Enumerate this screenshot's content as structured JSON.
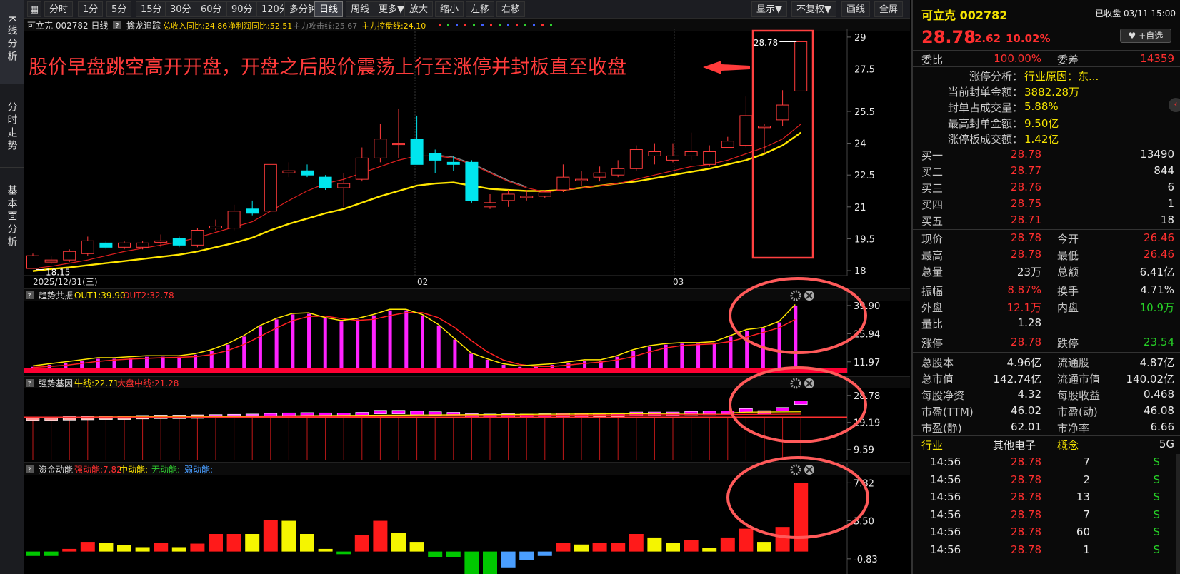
{
  "sidebar": {
    "tabs": [
      "K线分析",
      "分时走势",
      "基本面分析"
    ]
  },
  "toolbar": {
    "periods": [
      "分时",
      "1分",
      "5分",
      "15分",
      "30分",
      "60分",
      "90分",
      "120分",
      "多分钟",
      "日线",
      "周线",
      "更多▼"
    ],
    "active_period": "日线",
    "actions": [
      "放大",
      "缩小",
      "左移",
      "右移"
    ],
    "right_actions": [
      "显示▼",
      "不复权▼",
      "画线",
      "全屏"
    ]
  },
  "chart_header": {
    "symbol_tag": "可立克 002782 日线",
    "help": "?",
    "indicator_name": "擒龙追踪",
    "income": "总收入同比:24.86",
    "profit": "净利润同比:52.51",
    "attack": "主力攻击线:25.67",
    "control": "主力控盘线:24.10"
  },
  "annotation": {
    "text": "股价早盘跳空高开开盘，开盘之后股价震荡上行至涨停并封板直至收盘",
    "arrow": "←"
  },
  "price_labels": {
    "high_marker": "28.78",
    "low_marker": "18.15"
  },
  "x_axis": {
    "date_start": "2025/12/31(三)",
    "month_02": "02",
    "month_03": "03"
  },
  "panel1": {
    "help": "?",
    "name": "趋势共振",
    "out1": "OUT1:39.90",
    "out2": "OUT2:32.78",
    "ticks": [
      "39.90",
      "25.94",
      "11.97"
    ]
  },
  "panel2": {
    "help": "?",
    "name": "强势基因",
    "bull": "牛线:22.71",
    "market": "大盘中线:21.28",
    "ticks": [
      "28.78",
      "19.19",
      "9.59"
    ]
  },
  "panel3": {
    "help": "?",
    "name": "资金动能",
    "strong": "强动能:7.82",
    "medium": "中动能:-",
    "none": "无动能:-",
    "weak": "弱动能:-",
    "ticks": [
      "7.82",
      "3.50",
      "-0.83"
    ]
  },
  "chart_data": {
    "type": "candlestick",
    "y_ticks": [
      29.0,
      27.5,
      25.5,
      24.0,
      22.5,
      21.0,
      19.5,
      18.0
    ],
    "ylim": [
      17.9,
      29.4
    ],
    "candles": [
      {
        "o": 18.1,
        "c": 18.7,
        "h": 18.8,
        "l": 18.1
      },
      {
        "o": 18.4,
        "c": 18.5,
        "h": 18.7,
        "l": 18.3
      },
      {
        "o": 18.5,
        "c": 18.9,
        "h": 19.0,
        "l": 18.4
      },
      {
        "o": 18.8,
        "c": 19.4,
        "h": 19.6,
        "l": 18.7
      },
      {
        "o": 19.3,
        "c": 19.1,
        "h": 19.4,
        "l": 19.0
      },
      {
        "o": 19.1,
        "c": 19.3,
        "h": 19.4,
        "l": 19.0
      },
      {
        "o": 19.1,
        "c": 19.3,
        "h": 19.4,
        "l": 19.0
      },
      {
        "o": 19.4,
        "c": 19.4,
        "h": 19.7,
        "l": 19.1
      },
      {
        "o": 19.5,
        "c": 19.2,
        "h": 19.6,
        "l": 19.1
      },
      {
        "o": 19.2,
        "c": 19.9,
        "h": 20.0,
        "l": 19.1
      },
      {
        "o": 20.0,
        "c": 20.1,
        "h": 20.4,
        "l": 19.9
      },
      {
        "o": 20.0,
        "c": 20.8,
        "h": 21.1,
        "l": 19.9
      },
      {
        "o": 20.9,
        "c": 20.7,
        "h": 21.3,
        "l": 20.6
      },
      {
        "o": 20.8,
        "c": 23.0,
        "h": 23.0,
        "l": 20.8
      },
      {
        "o": 22.6,
        "c": 22.7,
        "h": 23.1,
        "l": 22.4
      },
      {
        "o": 22.7,
        "c": 22.5,
        "h": 23.0,
        "l": 22.4
      },
      {
        "o": 22.4,
        "c": 21.9,
        "h": 22.5,
        "l": 21.8
      },
      {
        "o": 21.9,
        "c": 22.1,
        "h": 22.6,
        "l": 21.0
      },
      {
        "o": 22.3,
        "c": 23.3,
        "h": 23.8,
        "l": 22.2
      },
      {
        "o": 23.3,
        "c": 24.2,
        "h": 24.9,
        "l": 23.1
      },
      {
        "o": 24.0,
        "c": 24.0,
        "h": 25.6,
        "l": 23.3
      },
      {
        "o": 24.2,
        "c": 23.0,
        "h": 25.3,
        "l": 23.0
      },
      {
        "o": 23.5,
        "c": 23.2,
        "h": 23.7,
        "l": 22.6
      },
      {
        "o": 23.1,
        "c": 23.0,
        "h": 23.4,
        "l": 22.7
      },
      {
        "o": 23.1,
        "c": 21.3,
        "h": 23.2,
        "l": 21.2
      },
      {
        "o": 21.0,
        "c": 21.2,
        "h": 21.6,
        "l": 20.9
      },
      {
        "o": 21.3,
        "c": 21.6,
        "h": 21.8,
        "l": 21.0
      },
      {
        "o": 21.5,
        "c": 21.5,
        "h": 21.8,
        "l": 21.3
      },
      {
        "o": 21.5,
        "c": 21.7,
        "h": 21.8,
        "l": 21.4
      },
      {
        "o": 21.8,
        "c": 22.4,
        "h": 23.0,
        "l": 21.7
      },
      {
        "o": 22.3,
        "c": 22.3,
        "h": 22.7,
        "l": 22.0
      },
      {
        "o": 22.4,
        "c": 22.6,
        "h": 22.9,
        "l": 22.2
      },
      {
        "o": 22.5,
        "c": 22.8,
        "h": 23.2,
        "l": 22.4
      },
      {
        "o": 22.8,
        "c": 23.7,
        "h": 23.9,
        "l": 22.7
      },
      {
        "o": 23.4,
        "c": 23.6,
        "h": 24.0,
        "l": 23.0
      },
      {
        "o": 23.2,
        "c": 23.4,
        "h": 24.0,
        "l": 23.1
      },
      {
        "o": 23.4,
        "c": 23.6,
        "h": 24.5,
        "l": 23.2
      },
      {
        "o": 23.0,
        "c": 23.6,
        "h": 23.9,
        "l": 22.9
      },
      {
        "o": 23.8,
        "c": 24.1,
        "h": 24.3,
        "l": 23.8
      },
      {
        "o": 23.9,
        "c": 25.3,
        "h": 26.2,
        "l": 23.8
      },
      {
        "o": 24.8,
        "c": 24.8,
        "h": 24.9,
        "l": 23.5
      },
      {
        "o": 25.1,
        "c": 25.8,
        "h": 26.5,
        "l": 24.8
      },
      {
        "o": 26.46,
        "c": 28.78,
        "h": 28.78,
        "l": 26.46
      }
    ],
    "ma_red": [
      18.1,
      18.2,
      18.35,
      18.5,
      18.7,
      18.9,
      19.05,
      19.2,
      19.35,
      19.55,
      19.8,
      20.05,
      20.3,
      20.8,
      21.3,
      21.75,
      22.1,
      22.3,
      22.6,
      22.9,
      23.2,
      23.4,
      23.4,
      23.3,
      23.0,
      22.6,
      22.2,
      21.9,
      21.7,
      21.8,
      21.9,
      22.0,
      22.1,
      22.3,
      22.5,
      22.7,
      22.9,
      23.0,
      23.2,
      23.5,
      23.8,
      24.2,
      24.9
    ],
    "ma_yellow": [
      17.98,
      18.08,
      18.15,
      18.25,
      18.35,
      18.45,
      18.55,
      18.65,
      18.75,
      18.9,
      19.1,
      19.3,
      19.55,
      19.9,
      20.2,
      20.45,
      20.7,
      20.9,
      21.2,
      21.5,
      21.75,
      22.0,
      22.1,
      22.15,
      22.0,
      21.85,
      21.8,
      21.75,
      21.75,
      21.8,
      21.9,
      22.0,
      22.1,
      22.2,
      22.35,
      22.5,
      22.65,
      22.8,
      23.0,
      23.2,
      23.5,
      23.9,
      24.5
    ],
    "trend": {
      "ylim": [
        8,
        42
      ],
      "bars": [
        9.5,
        10.5,
        11.5,
        12.5,
        13.5,
        13.5,
        14,
        14.5,
        14.5,
        14.5,
        15.5,
        17.5,
        20.5,
        24.5,
        29.5,
        33,
        35.5,
        35.8,
        33.5,
        32,
        33,
        35,
        37.5,
        37.5,
        35,
        30,
        23,
        16,
        13,
        10.5,
        9.5,
        10,
        10.5,
        11.5,
        12.5,
        12.5,
        14.5,
        17.5,
        19.5,
        20.5,
        21,
        21,
        21.5,
        24.5,
        27.5,
        28.5,
        31.5,
        39.9
      ]
    },
    "gene": {
      "ylim": [
        7,
        31
      ],
      "blocks": [
        {
          "v": 21.2,
          "col": "#ff9999"
        },
        {
          "v": 21.2,
          "col": "#ff9999"
        },
        {
          "v": 21.3,
          "col": "#ffb0b0"
        },
        {
          "v": 21.4,
          "col": "#ffb0b0"
        },
        {
          "v": 21.5,
          "col": "#ffb0b0"
        },
        {
          "v": 21.5,
          "col": "#ffb0b0"
        },
        {
          "v": 21.7,
          "col": "#ffb0b0"
        },
        {
          "v": 21.8,
          "col": "#ffb0b0"
        },
        {
          "v": 21.8,
          "col": "#ffb0b0"
        },
        {
          "v": 21.9,
          "col": "#ffb0b0"
        },
        {
          "v": 22.0,
          "col": "#ff66ff"
        },
        {
          "v": 22.1,
          "col": "#ff66ff"
        },
        {
          "v": 22.2,
          "col": "#ff66ff"
        },
        {
          "v": 22.4,
          "col": "#ff00ff"
        },
        {
          "v": 22.6,
          "col": "#ff00ff"
        },
        {
          "v": 22.7,
          "col": "#ff00ff"
        },
        {
          "v": 22.6,
          "col": "#ff00ff"
        },
        {
          "v": 22.5,
          "col": "#ff00ff"
        },
        {
          "v": 22.8,
          "col": "#ff00ff"
        },
        {
          "v": 23.5,
          "col": "#ff00ff"
        },
        {
          "v": 23.5,
          "col": "#ff00ff"
        },
        {
          "v": 23.2,
          "col": "#ff00ff"
        },
        {
          "v": 23.0,
          "col": "#ff00ff"
        },
        {
          "v": 22.8,
          "col": "#ff00ff"
        },
        {
          "v": 22.3,
          "col": "#ff00ff"
        },
        {
          "v": 22.2,
          "col": "#ff00ff"
        },
        {
          "v": 22.3,
          "col": "#ff00ff"
        },
        {
          "v": 22.2,
          "col": "#ff00ff"
        },
        {
          "v": 22.3,
          "col": "#ff00ff"
        },
        {
          "v": 22.5,
          "col": "#ff00ff"
        },
        {
          "v": 22.5,
          "col": "#ff00ff"
        },
        {
          "v": 22.6,
          "col": "#ff00ff"
        },
        {
          "v": 22.6,
          "col": "#ff00ff"
        },
        {
          "v": 22.9,
          "col": "#ff00ff"
        },
        {
          "v": 22.9,
          "col": "#ff00ff"
        },
        {
          "v": 22.9,
          "col": "#ff00ff"
        },
        {
          "v": 23.1,
          "col": "#ff00ff"
        },
        {
          "v": 23.2,
          "col": "#ff00ff"
        },
        {
          "v": 23.3,
          "col": "#ff00ff"
        },
        {
          "v": 24.1,
          "col": "#ff00ff"
        },
        {
          "v": 23.4,
          "col": "#ff00ff"
        },
        {
          "v": 24.5,
          "col": "#ff00ff"
        },
        {
          "v": 26.8,
          "col": "#ff00ff"
        }
      ]
    },
    "fund": {
      "ylim": [
        -1.9,
        8.5
      ],
      "bars": [
        {
          "v": -0.5,
          "col": "#00c800"
        },
        {
          "v": -0.5,
          "col": "#00c800"
        },
        {
          "v": 0.3,
          "col": "#ff1a1a"
        },
        {
          "v": 1.1,
          "col": "#ff1a1a"
        },
        {
          "v": 1.0,
          "col": "#f5f500"
        },
        {
          "v": 0.7,
          "col": "#f5f500"
        },
        {
          "v": 0.5,
          "col": "#f5f500"
        },
        {
          "v": 1.0,
          "col": "#ff1a1a"
        },
        {
          "v": 0.5,
          "col": "#f5f500"
        },
        {
          "v": 0.9,
          "col": "#ff1a1a"
        },
        {
          "v": 2.0,
          "col": "#ff1a1a"
        },
        {
          "v": 2.0,
          "col": "#ff1a1a"
        },
        {
          "v": 2.0,
          "col": "#f5f500"
        },
        {
          "v": 3.6,
          "col": "#ff1a1a"
        },
        {
          "v": 3.5,
          "col": "#f5f500"
        },
        {
          "v": 2.0,
          "col": "#f5f500"
        },
        {
          "v": 0.3,
          "col": "#f5f500"
        },
        {
          "v": -0.3,
          "col": "#00c800"
        },
        {
          "v": 1.9,
          "col": "#ff1a1a"
        },
        {
          "v": 3.5,
          "col": "#ff1a1a"
        },
        {
          "v": 2.1,
          "col": "#f5f500"
        },
        {
          "v": 1.1,
          "col": "#f5f500"
        },
        {
          "v": -0.6,
          "col": "#00c800"
        },
        {
          "v": -0.6,
          "col": "#00c800"
        },
        {
          "v": -2.6,
          "col": "#00c800"
        },
        {
          "v": -3.8,
          "col": "#00c800"
        },
        {
          "v": -1.8,
          "col": "#4a9eff"
        },
        {
          "v": -1.0,
          "col": "#4a9eff"
        },
        {
          "v": -0.5,
          "col": "#4a9eff"
        },
        {
          "v": 1.0,
          "col": "#ff1a1a"
        },
        {
          "v": 0.8,
          "col": "#f5f500"
        },
        {
          "v": 1.0,
          "col": "#ff1a1a"
        },
        {
          "v": 1.0,
          "col": "#ff1a1a"
        },
        {
          "v": 2.0,
          "col": "#ff1a1a"
        },
        {
          "v": 1.6,
          "col": "#f5f500"
        },
        {
          "v": 1.0,
          "col": "#f5f500"
        },
        {
          "v": 1.3,
          "col": "#ff1a1a"
        },
        {
          "v": 0.4,
          "col": "#f5f500"
        },
        {
          "v": 1.6,
          "col": "#ff1a1a"
        },
        {
          "v": 2.6,
          "col": "#ff1a1a"
        },
        {
          "v": 1.1,
          "col": "#f5f500"
        },
        {
          "v": 2.8,
          "col": "#ff1a1a"
        },
        {
          "v": 7.82,
          "col": "#ff1a1a"
        }
      ]
    }
  },
  "right_panel": {
    "title": "可立克 002782",
    "status": "已收盘 03/11 15:00",
    "price": "28.78",
    "change": "2.62",
    "change_pct": "10.02%",
    "fav_button": "♥ +自选",
    "weibi_label": "委比",
    "weibi_value": "100.00%",
    "weicha_label": "委差",
    "weicha_value": "14359",
    "limit_analysis": [
      {
        "label": "涨停分析：",
        "value": "行业原因：东..."
      },
      {
        "label": "当前封单金额：",
        "value": "3882.28万"
      },
      {
        "label": "封单占成交量：",
        "value": "5.88%"
      },
      {
        "label": "最高封单金额：",
        "value": "9.50亿"
      },
      {
        "label": "涨停板成交额：",
        "value": "1.42亿"
      }
    ],
    "bids": [
      {
        "label": "买一",
        "price": "28.78",
        "vol": "13490"
      },
      {
        "label": "买二",
        "price": "28.77",
        "vol": "844"
      },
      {
        "label": "买三",
        "price": "28.76",
        "vol": "6"
      },
      {
        "label": "买四",
        "price": "28.75",
        "vol": "1"
      },
      {
        "label": "买五",
        "price": "28.71",
        "vol": "18"
      }
    ],
    "stats": [
      {
        "l1": "现价",
        "v1": "28.78",
        "c1": "red",
        "l2": "今开",
        "v2": "26.46",
        "c2": "red"
      },
      {
        "l1": "最高",
        "v1": "28.78",
        "c1": "red",
        "l2": "最低",
        "v2": "26.46",
        "c2": "red"
      },
      {
        "l1": "总量",
        "v1": "23万",
        "c1": "white",
        "l2": "总额",
        "v2": "6.41亿",
        "c2": "white"
      },
      {
        "l1": "振幅",
        "v1": "8.87%",
        "c1": "red",
        "l2": "换手",
        "v2": "4.71%",
        "c2": "white"
      },
      {
        "l1": "外盘",
        "v1": "12.1万",
        "c1": "red",
        "l2": "内盘",
        "v2": "10.9万",
        "c2": "green"
      },
      {
        "l1": "量比",
        "v1": "1.28",
        "c1": "white",
        "l2": "",
        "v2": "",
        "c2": "white"
      },
      {
        "l1": "涨停",
        "v1": "28.78",
        "c1": "red",
        "l2": "跌停",
        "v2": "23.54",
        "c2": "green"
      },
      {
        "l1": "总股本",
        "v1": "4.96亿",
        "c1": "white",
        "l2": "流通股",
        "v2": "4.87亿",
        "c2": "white"
      },
      {
        "l1": "总市值",
        "v1": "142.74亿",
        "c1": "white",
        "l2": "流通市值",
        "v2": "140.02亿",
        "c2": "white"
      },
      {
        "l1": "每股净资",
        "v1": "4.32",
        "c1": "white",
        "l2": "每股收益",
        "v2": "0.468",
        "c2": "white"
      },
      {
        "l1": "市盈(TTM)",
        "v1": "46.02",
        "c1": "white",
        "l2": "市盈(动)",
        "v2": "46.08",
        "c2": "white"
      },
      {
        "l1": "市盈(静)",
        "v1": "62.01",
        "c1": "white",
        "l2": "市净率",
        "v2": "6.66",
        "c2": "white"
      }
    ],
    "industry_label": "行业",
    "industry_value": "其他电子",
    "concept_label": "概念",
    "concept_value": "5G",
    "ticks": [
      {
        "time": "14:56",
        "price": "28.78",
        "vol": "7",
        "side": "S"
      },
      {
        "time": "14:56",
        "price": "28.78",
        "vol": "2",
        "side": "S"
      },
      {
        "time": "14:56",
        "price": "28.78",
        "vol": "13",
        "side": "S"
      },
      {
        "time": "14:56",
        "price": "28.78",
        "vol": "7",
        "side": "S"
      },
      {
        "time": "14:56",
        "price": "28.78",
        "vol": "60",
        "side": "S"
      },
      {
        "time": "14:56",
        "price": "28.78",
        "vol": "1",
        "side": "S"
      }
    ]
  }
}
